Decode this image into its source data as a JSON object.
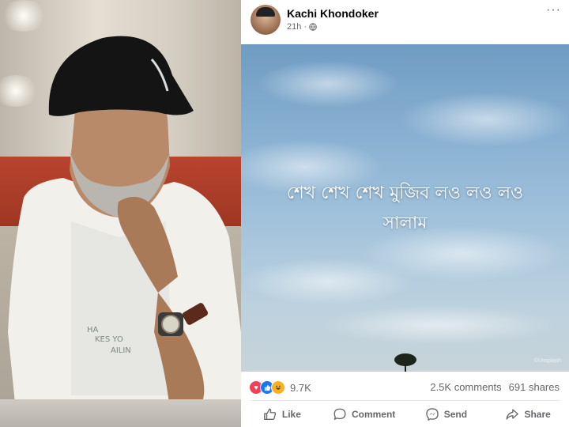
{
  "post": {
    "author": "Kachi Khondoker",
    "time": "21h",
    "time_separator": "·",
    "more_label": "···",
    "overlay_line1": "শেখ শেখ শেখ মুজিব লও লও লও",
    "overlay_line2": "সালাম",
    "reaction_count": "9.7K",
    "comments": "2.5K comments",
    "shares": "691 shares",
    "watermark": "©Unsplash"
  },
  "actions": [
    {
      "label": "Like",
      "icon": "thumbs-up-icon"
    },
    {
      "label": "Comment",
      "icon": "comment-bubble-icon"
    },
    {
      "label": "Send",
      "icon": "messenger-icon"
    },
    {
      "label": "Share",
      "icon": "share-arrow-icon"
    }
  ],
  "reactions": [
    {
      "icon": "love-heart-icon",
      "color": "#f33e58"
    },
    {
      "icon": "like-thumb-icon",
      "color": "#1877f2"
    },
    {
      "icon": "haha-laugh-icon",
      "color": "#f7b125"
    }
  ],
  "colors": {
    "secondary_text": "#65676b",
    "primary_text": "#050505",
    "divider": "#e4e6eb"
  }
}
